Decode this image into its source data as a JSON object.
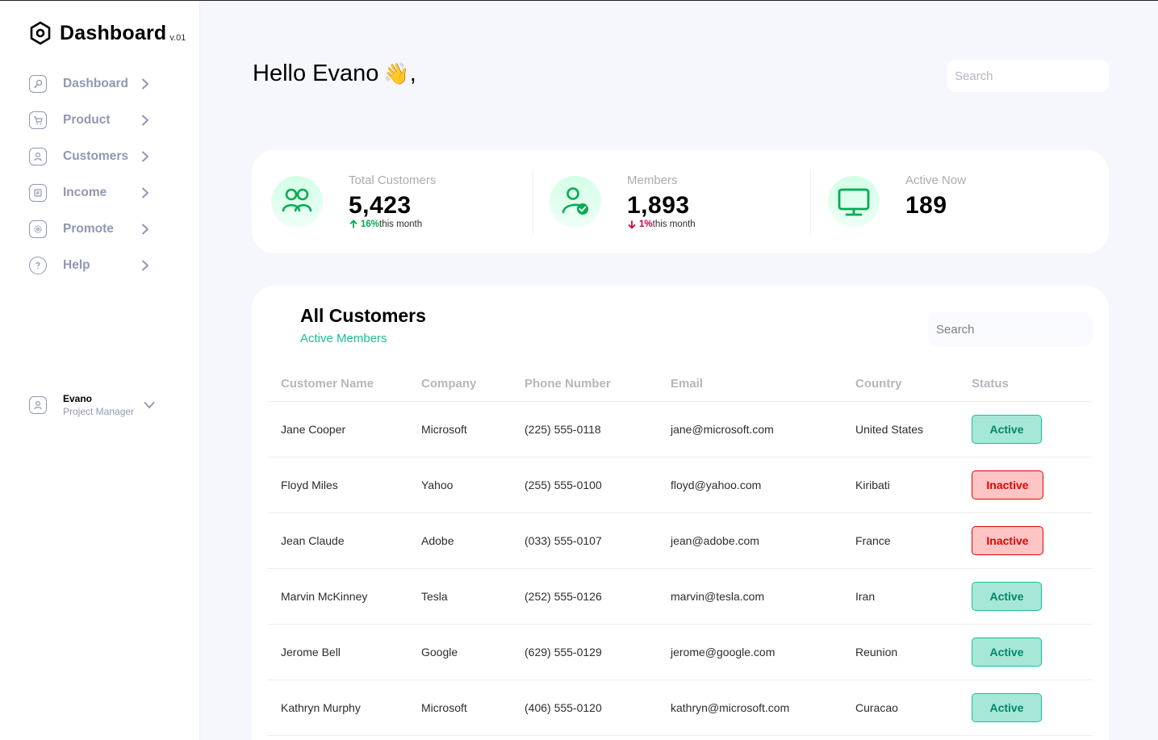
{
  "brand": {
    "title": "Dashboard",
    "version": "v.01"
  },
  "sidebar": {
    "items": [
      {
        "label": "Dashboard",
        "icon": "key-icon"
      },
      {
        "label": "Product",
        "icon": "cube-icon"
      },
      {
        "label": "Customers",
        "icon": "user-square-icon"
      },
      {
        "label": "Income",
        "icon": "wallet-icon"
      },
      {
        "label": "Promote",
        "icon": "discount-icon"
      },
      {
        "label": "Help",
        "icon": "help-icon"
      }
    ],
    "profile": {
      "name": "Evano",
      "role": "Project Manager"
    }
  },
  "header": {
    "greeting": "Hello Evano",
    "wave": "👋",
    "comma": ",",
    "search_placeholder": "Search"
  },
  "stats": [
    {
      "label": "Total Customers",
      "value": "5,423",
      "delta": "16%",
      "delta_suffix": "this month",
      "direction": "up",
      "icon": "users-icon"
    },
    {
      "label": "Members",
      "value": "1,893",
      "delta": "1%",
      "delta_suffix": "this month",
      "direction": "down",
      "icon": "user-check-icon"
    },
    {
      "label": "Active Now",
      "value": "189",
      "icon": "monitor-icon"
    }
  ],
  "customers": {
    "title": "All Customers",
    "subtitle": "Active Members",
    "search_placeholder": "Search",
    "columns": [
      "Customer Name",
      "Company",
      "Phone Number",
      "Email",
      "Country",
      "Status"
    ],
    "rows": [
      {
        "name": "Jane Cooper",
        "company": "Microsoft",
        "phone": "(225) 555-0118",
        "email": "jane@microsoft.com",
        "country": "United States",
        "status": "Active"
      },
      {
        "name": "Floyd Miles",
        "company": "Yahoo",
        "phone": "(255) 555-0100",
        "email": "floyd@yahoo.com",
        "country": "Kiribati",
        "status": "Inactive"
      },
      {
        "name": "Jean Claude",
        "company": "Adobe",
        "phone": "(033) 555-0107",
        "email": "jean@adobe.com",
        "country": "France",
        "status": "Inactive"
      },
      {
        "name": "Marvin McKinney",
        "company": "Tesla",
        "phone": "(252) 555-0126",
        "email": "marvin@tesla.com",
        "country": "Iran",
        "status": "Active"
      },
      {
        "name": "Jerome Bell",
        "company": "Google",
        "phone": "(629) 555-0129",
        "email": "jerome@google.com",
        "country": "Reunion",
        "status": "Active"
      },
      {
        "name": "Kathryn Murphy",
        "company": "Microsoft",
        "phone": "(406) 555-0120",
        "email": "kathryn@microsoft.com",
        "country": "Curacao",
        "status": "Active"
      }
    ]
  },
  "colors": {
    "accent": "#16c098",
    "muted": "#9197b3",
    "active_bg": "#a6e7d8",
    "inactive_bg": "#ffc5c5",
    "background": "#f6f7fd"
  }
}
